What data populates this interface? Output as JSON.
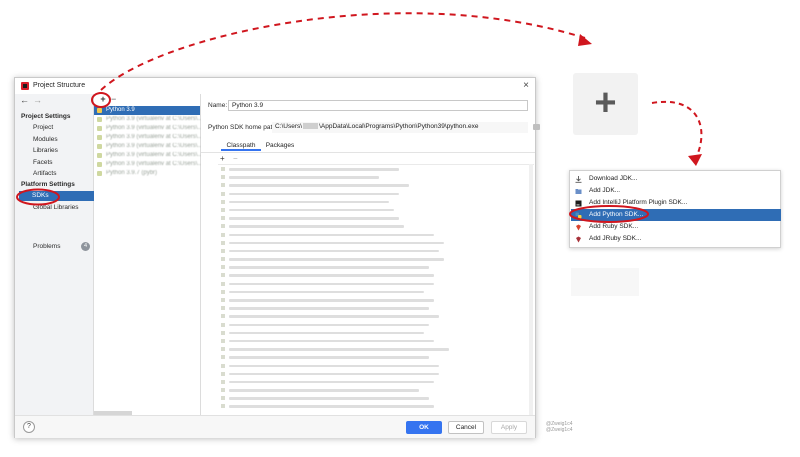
{
  "dialog": {
    "title": "Project Structure",
    "close_glyph": "×",
    "nav_back": "←",
    "nav_forward": "→",
    "sidebar": {
      "project_settings_header": "Project Settings",
      "project_items": [
        "Project",
        "Modules",
        "Libraries",
        "Facets",
        "Artifacts"
      ],
      "platform_settings_header": "Platform Settings",
      "platform_items": [
        "SDKs",
        "Global Libraries"
      ],
      "problems_label": "Problems",
      "problems_count": "4"
    },
    "sdk_list": {
      "add_glyph": "+",
      "remove_glyph": "−",
      "items": [
        "Python 3.9",
        "Python 3.9 (virtualenv at C:\\Users\\...)",
        "Python 3.9 (virtualenv at C:\\Users\\...)",
        "Python 3.9 (virtualenv at C:\\Users\\...)",
        "Python 3.9 (virtualenv at C:\\Users\\...)",
        "Python 3.9 (virtualenv at C:\\Users\\...)",
        "Python 3.9 (virtualenv at C:\\Users\\...)",
        "Python 3.9.7 (pybr)"
      ],
      "selected_index": 0
    },
    "details": {
      "name_label": "Name:",
      "name_value": "Python 3.9",
      "home_path_label": "Python SDK home path:",
      "home_path_prefix": "C:\\Users\\",
      "home_path_suffix": "\\AppData\\Local\\Programs\\Python\\Python39\\python.exe",
      "tabs": [
        "Classpath",
        "Packages"
      ],
      "active_tab": "Classpath",
      "classpath_add": "+",
      "classpath_remove": "−"
    },
    "footer": {
      "help_glyph": "?",
      "ok_label": "OK",
      "cancel_label": "Cancel",
      "apply_label": "Apply"
    }
  },
  "zoom": {
    "plus_glyph": "+"
  },
  "popup_menu": {
    "items": [
      {
        "label": "Download JDK...",
        "icon": "download-icon"
      },
      {
        "label": "Add JDK...",
        "icon": "folder-icon"
      },
      {
        "label": "Add IntelliJ Platform Plugin SDK...",
        "icon": "plugin-icon"
      },
      {
        "label": "Add Python SDK...",
        "icon": "python-icon"
      },
      {
        "label": "Add Ruby SDK...",
        "icon": "ruby-icon"
      },
      {
        "label": "Add JRuby SDK...",
        "icon": "jruby-icon"
      }
    ],
    "highlighted_index": 3
  },
  "credit": {
    "line1": "@Zweig1c4",
    "line2": "@Zweig1c4"
  },
  "colors": {
    "accent_blue": "#3574f0",
    "selection_blue": "#2f6db5",
    "annotation_red": "#d0161e"
  }
}
